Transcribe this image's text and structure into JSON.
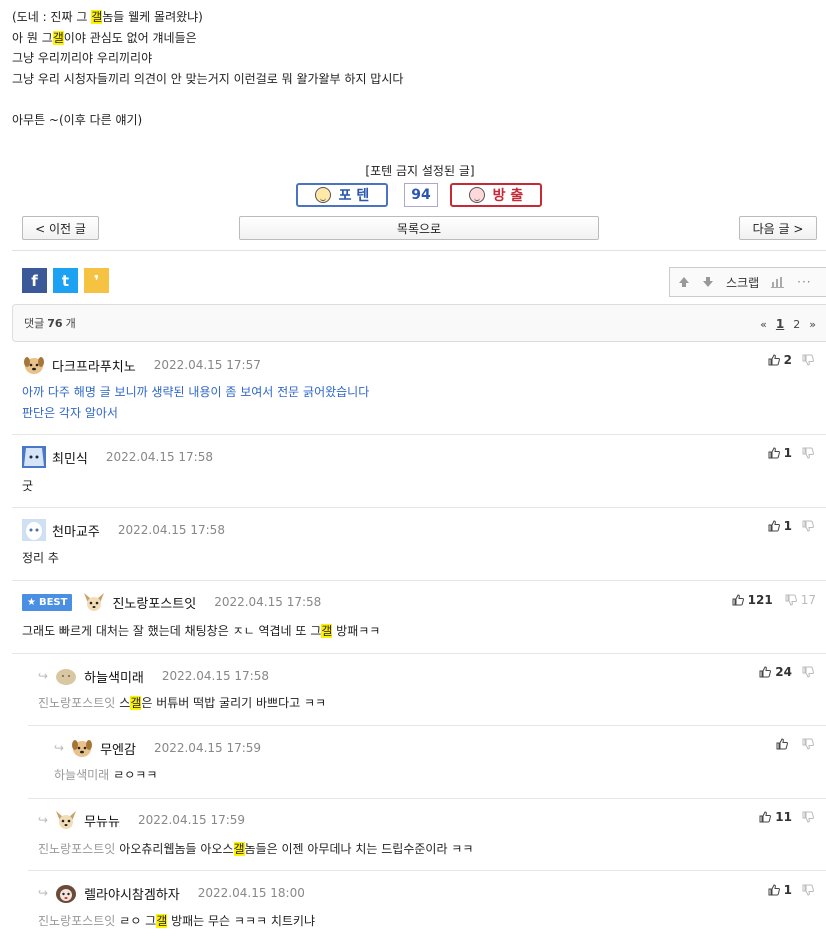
{
  "post": {
    "lines": [
      [
        "(도네 : 진짜 그 ",
        "갤",
        "놈들 웰케 몰려왔냐)"
      ],
      [
        "아 뭔 그",
        "갤",
        "이야 관심도 없어 걔네들은"
      ],
      [
        "그냥 우리끼리야 우리끼리야",
        "",
        ""
      ],
      [
        "그냥 우리 시청자들끼리 의견이 안 맞는거지 이런걸로 뭐 왈가왈부 하지 맙시다",
        "",
        ""
      ],
      [
        "",
        "",
        ""
      ],
      [
        "아무튼 ~(이후 다른 얘기)",
        "",
        ""
      ]
    ]
  },
  "potten": {
    "note": "[포텐 금지 설정된 글]",
    "potten_label": "포 텐",
    "count": "94",
    "out_label": "방 출"
  },
  "nav": {
    "prev": "< 이전 글",
    "list": "목록으로",
    "next": "다음 글 >"
  },
  "share": {
    "facebook": "f",
    "twitter": "t",
    "kakao": "❜"
  },
  "toolbox": {
    "scrap": "스크랩"
  },
  "comments_bar": {
    "prefix": "댓글",
    "count": "76",
    "suffix": "개",
    "pages": [
      "1",
      "2"
    ],
    "current_page": "1"
  },
  "comments": [
    {
      "nick": "다크프라푸치노",
      "date": "2022.04.15 17:57",
      "reply_to": "",
      "text_pre": "아까 다주 해명 글 보니까 생략된 내용이 좀 보여서 전문 긁어왔습니다",
      "text_hl": "",
      "text_post": "",
      "text2": "판단은 각자 알아서",
      "up": "2",
      "down": "",
      "best": false
    },
    {
      "nick": "최민식",
      "date": "2022.04.15 17:58",
      "reply_to": "",
      "text_pre": "굿",
      "text_hl": "",
      "text_post": "",
      "text2": "",
      "up": "1",
      "down": "",
      "best": false
    },
    {
      "nick": "천마교주",
      "date": "2022.04.15 17:58",
      "reply_to": "",
      "text_pre": "정리 추",
      "text_hl": "",
      "text_post": "",
      "text2": "",
      "up": "1",
      "down": "",
      "best": false
    },
    {
      "nick": "진노랑포스트잇",
      "date": "2022.04.15 17:58",
      "reply_to": "",
      "text_pre": "그래도 빠르게 대처는 잘 했는데 채팅창은 ㅈㄴ 역겹네 또 그",
      "text_hl": "갤",
      "text_post": " 방패ㅋㅋ",
      "text2": "",
      "up": "121",
      "down": "17",
      "best": true,
      "best_label": "BEST"
    },
    {
      "nick": "하늘색미래",
      "date": "2022.04.15 17:58",
      "reply_to": "진노랑포스트잇",
      "text_pre": "스",
      "text_hl": "갤",
      "text_post": "은 버튜버 떡밥 굴리기 바쁘다고 ㅋㅋ",
      "text2": "",
      "up": "24",
      "down": "",
      "best": false
    },
    {
      "nick": "무엔감",
      "date": "2022.04.15 17:59",
      "reply_to": "하늘색미래",
      "text_pre": "ㄹㅇㅋㅋ",
      "text_hl": "",
      "text_post": "",
      "text2": "",
      "up": "",
      "down": "",
      "best": false
    },
    {
      "nick": "무뉴뉴",
      "date": "2022.04.15 17:59",
      "reply_to": "진노랑포스트잇",
      "text_pre": "아오츄리웹놈들 아오스",
      "text_hl": "갤",
      "text_post": "놈들은 이젠 아무데나 치는 드립수준이라 ㅋㅋ",
      "text2": "",
      "up": "11",
      "down": "",
      "best": false
    },
    {
      "nick": "렐라야시참겜하자",
      "date": "2022.04.15 18:00",
      "reply_to": "진노랑포스트잇",
      "text_pre": "ㄹㅇ 그",
      "text_hl": "갤",
      "text_post": " 방패는 무슨 ㅋㅋㅋ 치트키냐",
      "text2": "",
      "up": "1",
      "down": "",
      "best": false
    }
  ]
}
